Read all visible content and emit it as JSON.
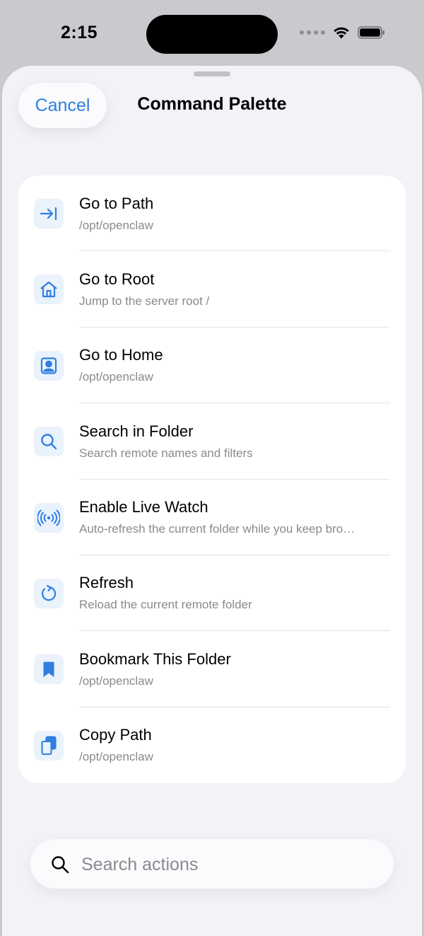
{
  "status_bar": {
    "time": "2:15"
  },
  "sheet": {
    "cancel_label": "Cancel",
    "title": "Command Palette"
  },
  "actions": [
    {
      "title": "Go to Path",
      "subtitle": "/opt/openclaw",
      "icon": "arrow-to-line-icon"
    },
    {
      "title": "Go to Root",
      "subtitle": "Jump to the server root /",
      "icon": "house-icon"
    },
    {
      "title": "Go to Home",
      "subtitle": "/opt/openclaw",
      "icon": "person-square-icon"
    },
    {
      "title": "Search in Folder",
      "subtitle": "Search remote names and filters",
      "icon": "magnifier-icon"
    },
    {
      "title": "Enable Live Watch",
      "subtitle": "Auto-refresh the current folder while you keep bro…",
      "icon": "antenna-waves-icon"
    },
    {
      "title": "Refresh",
      "subtitle": "Reload the current remote folder",
      "icon": "refresh-icon"
    },
    {
      "title": "Bookmark This Folder",
      "subtitle": "/opt/openclaw",
      "icon": "bookmark-icon"
    },
    {
      "title": "Copy Path",
      "subtitle": "/opt/openclaw",
      "icon": "copy-doc-icon"
    }
  ],
  "search": {
    "placeholder": "Search actions"
  },
  "colors": {
    "accent": "#2f7fe0",
    "icon_bg": "#eaf2fc",
    "sheet_bg": "#f2f2f7",
    "card_bg": "#ffffff",
    "secondary_text": "#8a8a8f"
  }
}
